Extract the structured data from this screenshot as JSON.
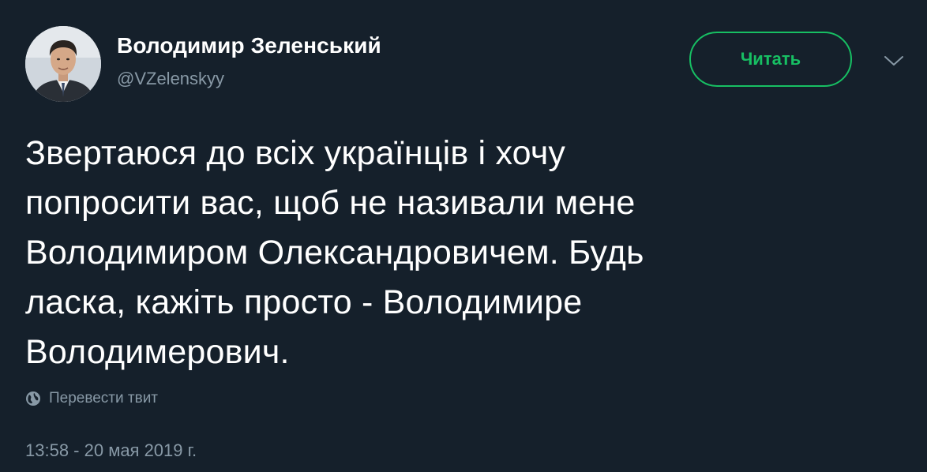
{
  "author": {
    "display_name": "Володимир Зеленський",
    "handle": "@VZelenskyy",
    "avatar_icon": "user-avatar"
  },
  "follow_button": {
    "label": "Читать",
    "color": "#17bf63"
  },
  "menu": {
    "icon": "chevron-down-icon"
  },
  "tweet": {
    "lines": [
      "Звертаюся до всіх українців і хочу",
      "попросити вас, щоб не називали мене",
      "Володимиром Олександровичем. Будь",
      "ласка, кажіть просто - Володимире",
      "Володимерович."
    ]
  },
  "translate": {
    "label": "Перевести твит",
    "icon": "globe-icon"
  },
  "timestamp": "13:58 - 20 мая 2019 г.",
  "colors": {
    "background": "#15202b",
    "text": "#ffffff",
    "secondary": "#8899a6",
    "accent": "#17bf63"
  }
}
